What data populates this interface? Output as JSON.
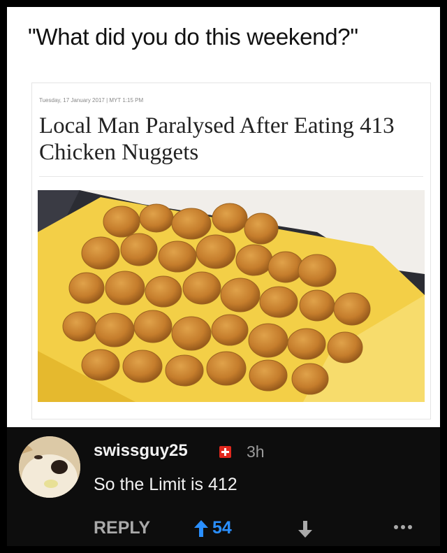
{
  "meme": {
    "caption": "\"What did you do this weekend?\""
  },
  "article": {
    "meta": "Tuesday, 17 January 2017 | MYT 1:15 PM",
    "headline": "Local Man Paralysed After Eating 413 Chicken Nuggets",
    "photo_subject": "box-of-chicken-nuggets"
  },
  "comment": {
    "username": "swissguy25",
    "flag": "swiss-flag-icon",
    "time": "3h",
    "text": "So the Limit is 412",
    "reply_label": "REPLY",
    "upvotes": "54",
    "colors": {
      "background": "#0d0d0d",
      "upvote": "#2a8fff",
      "muted": "#a9a9a9"
    }
  }
}
